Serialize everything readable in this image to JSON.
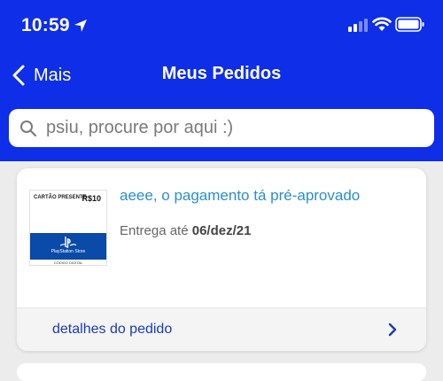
{
  "status_bar": {
    "time": "10:59"
  },
  "nav": {
    "back_label": "Mais",
    "title": "Meus Pedidos"
  },
  "search": {
    "placeholder": "psiu, procure por aqui :)"
  },
  "order": {
    "status": "aeee, o pagamento tá pré-aprovado",
    "delivery_label": "Entrega até",
    "delivery_date": "06/dez/21",
    "details_label": "detalhes do pedido",
    "product_image": {
      "tag": "CARTÃO PRESENTE",
      "price": "R$10",
      "store": "PlayStation Store",
      "footer": "CÓDIGO DIGITAL"
    }
  },
  "colors": {
    "header": "#0e2ee8",
    "status_text": "#2a8ed0",
    "details_link": "#1a3bb8"
  }
}
